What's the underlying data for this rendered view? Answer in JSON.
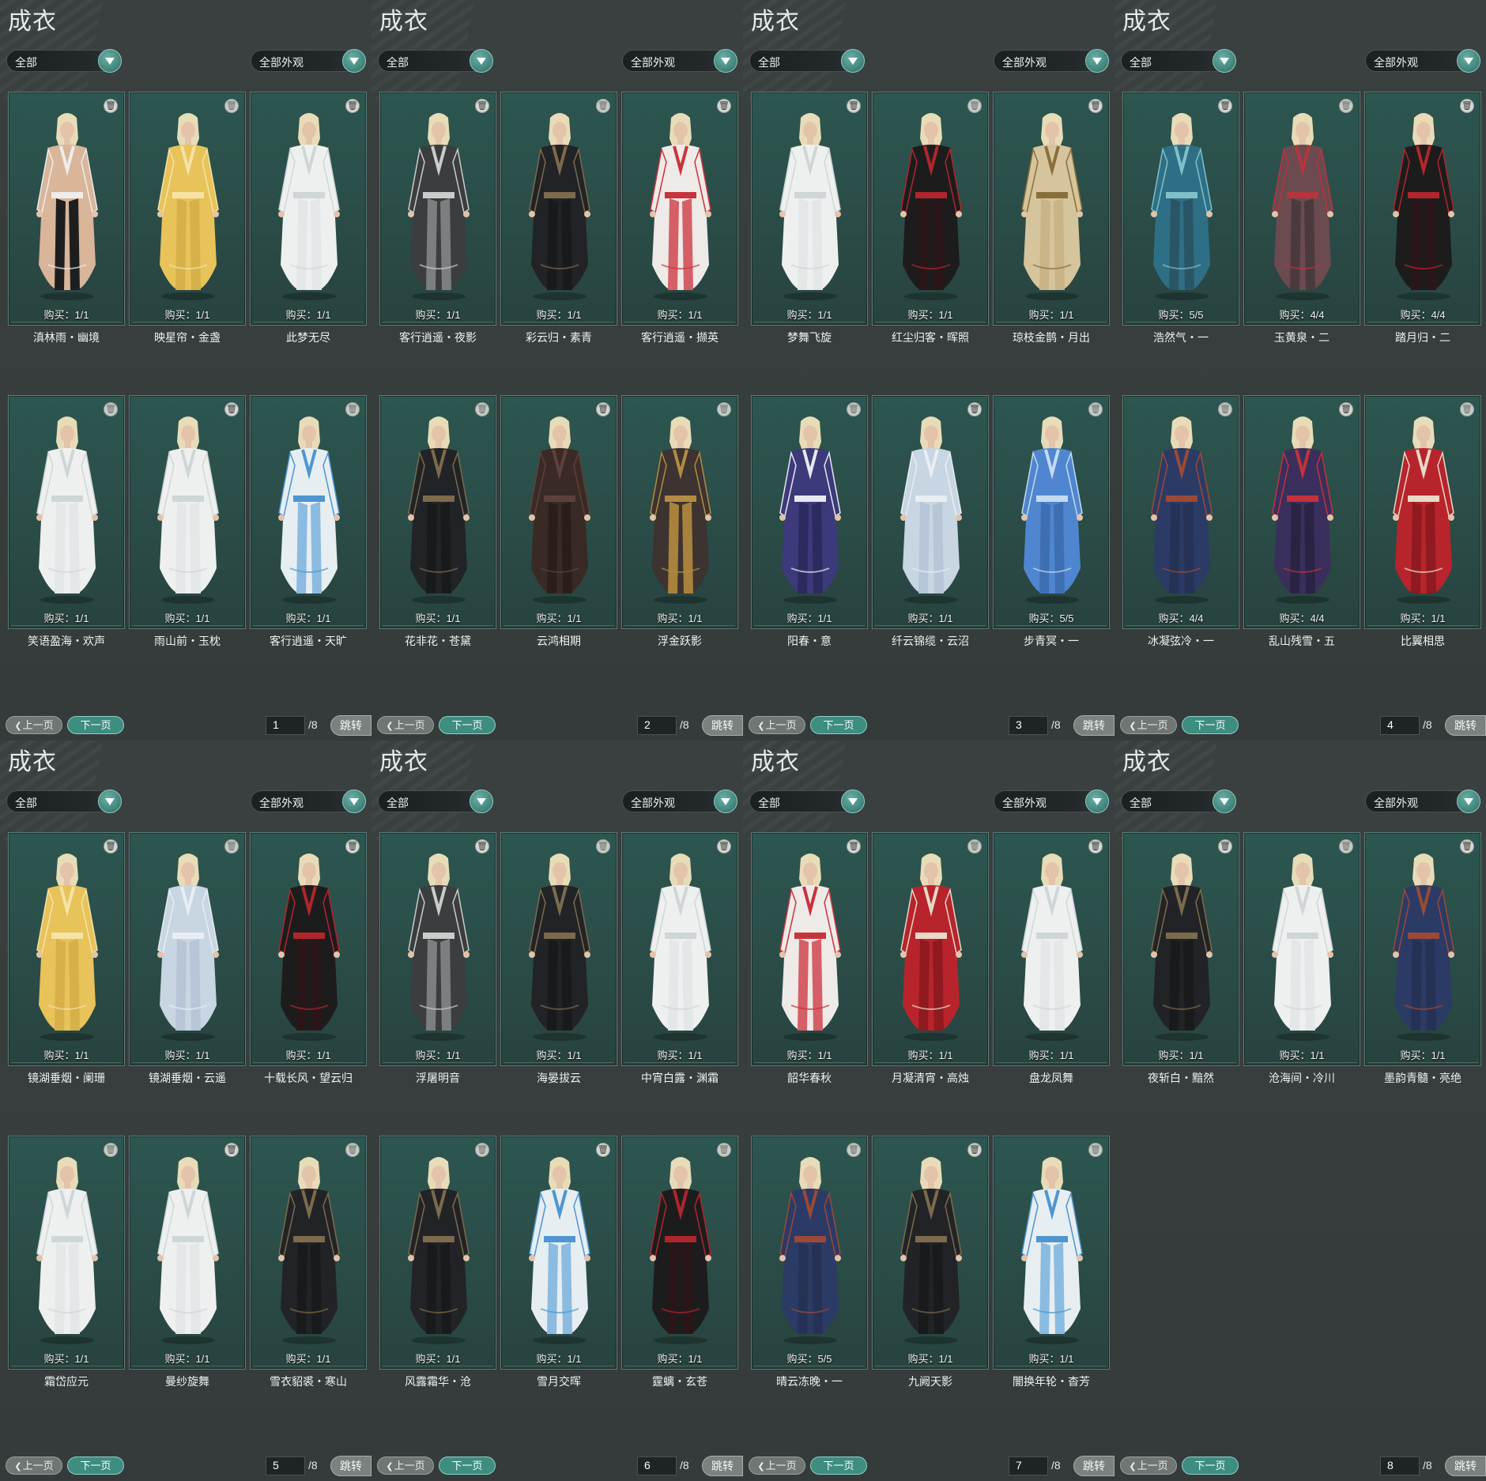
{
  "panels": [
    {
      "title": "成衣",
      "filter_category": "全部",
      "filter_appearance": "全部外观",
      "page": "1",
      "total_pages": "/8",
      "prev_label": "上一页",
      "next_label": "下一页",
      "jump_label": "跳转",
      "items": [
        {
          "name": "滇林雨・幽境",
          "purchase": "购买：1/1",
          "palette": "bare"
        },
        {
          "name": "映星帘・金盏",
          "purchase": "购买：1/1",
          "palette": "gold"
        },
        {
          "name": "此梦无尽",
          "purchase": "购买：1/1",
          "palette": "white"
        },
        {
          "name": "笑语盈海・欢声",
          "purchase": "购买：1/1",
          "palette": "white"
        },
        {
          "name": "雨山前・玉枕",
          "purchase": "购买：1/1",
          "palette": "white"
        },
        {
          "name": "客行逍遥・天旷",
          "purchase": "购买：1/1",
          "palette": "skyblue"
        }
      ]
    },
    {
      "title": "成衣",
      "filter_category": "全部",
      "filter_appearance": "全部外观",
      "page": "2",
      "total_pages": "/8",
      "prev_label": "上一页",
      "next_label": "下一页",
      "jump_label": "跳转",
      "items": [
        {
          "name": "客行逍遥・夜影",
          "purchase": "购买：1/1",
          "palette": "darkgrey"
        },
        {
          "name": "彩云归・素青",
          "purchase": "购买：1/1",
          "palette": "black"
        },
        {
          "name": "客行逍遥・撷英",
          "purchase": "购买：1/1",
          "palette": "whitered"
        },
        {
          "name": "花非花・苍黛",
          "purchase": "购买：1/1",
          "palette": "black"
        },
        {
          "name": "云鸿相期",
          "purchase": "购买：1/1",
          "palette": "darkbrown"
        },
        {
          "name": "浮金跃影",
          "purchase": "购买：1/1",
          "palette": "goldbrown"
        }
      ]
    },
    {
      "title": "成衣",
      "filter_category": "全部",
      "filter_appearance": "全部外观",
      "page": "3",
      "total_pages": "/8",
      "prev_label": "上一页",
      "next_label": "下一页",
      "jump_label": "跳转",
      "items": [
        {
          "name": "梦舞飞旋",
          "purchase": "购买：1/1",
          "palette": "white"
        },
        {
          "name": "红尘归客・晖照",
          "purchase": "购买：1/1",
          "palette": "blackred"
        },
        {
          "name": "琼枝金鹊・月出",
          "purchase": "购买：1/1",
          "palette": "beige"
        },
        {
          "name": "阳春・意",
          "purchase": "购买：1/1",
          "palette": "purple"
        },
        {
          "name": "纤云锦缆・云沼",
          "purchase": "购买：1/1",
          "palette": "paleblue"
        },
        {
          "name": "步青冥・一",
          "purchase": "购买：5/5",
          "palette": "blue"
        }
      ]
    },
    {
      "title": "成衣",
      "filter_category": "全部",
      "filter_appearance": "全部外观",
      "page": "4",
      "total_pages": "/8",
      "prev_label": "上一页",
      "next_label": "下一页",
      "jump_label": "跳转",
      "items": [
        {
          "name": "浩然气・一",
          "purchase": "购买：5/5",
          "palette": "teal"
        },
        {
          "name": "玉黄泉・二",
          "purchase": "购买：4/4",
          "palette": "redgrey"
        },
        {
          "name": "踏月归・二",
          "purchase": "购买：4/4",
          "palette": "blackred"
        },
        {
          "name": "冰凝弦冷・一",
          "purchase": "购买：4/4",
          "palette": "navy"
        },
        {
          "name": "乱山残雪・五",
          "purchase": "购买：4/4",
          "palette": "navyred"
        },
        {
          "name": "比翼相思",
          "purchase": "购买：1/1",
          "palette": "red"
        }
      ]
    },
    {
      "title": "成衣",
      "filter_category": "全部",
      "filter_appearance": "全部外观",
      "page": "5",
      "total_pages": "/8",
      "prev_label": "上一页",
      "next_label": "下一页",
      "jump_label": "跳转",
      "items": [
        {
          "name": "镜湖垂烟・阑珊",
          "purchase": "购买：1/1",
          "palette": "gold"
        },
        {
          "name": "镜湖垂烟・云遥",
          "purchase": "购买：1/1",
          "palette": "paleblue"
        },
        {
          "name": "十载长风・望云归",
          "purchase": "购买：1/1",
          "palette": "blackred"
        },
        {
          "name": "霜岱应元",
          "purchase": "购买：1/1",
          "palette": "white"
        },
        {
          "name": "曼纱旋舞",
          "purchase": "购买：1/1",
          "palette": "white"
        },
        {
          "name": "雪衣貂裘・寒山",
          "purchase": "购买：1/1",
          "palette": "black"
        }
      ]
    },
    {
      "title": "成衣",
      "filter_category": "全部",
      "filter_appearance": "全部外观",
      "page": "6",
      "total_pages": "/8",
      "prev_label": "上一页",
      "next_label": "下一页",
      "jump_label": "跳转",
      "items": [
        {
          "name": "浮屠明音",
          "purchase": "购买：1/1",
          "palette": "darkgrey"
        },
        {
          "name": "海晏拔云",
          "purchase": "购买：1/1",
          "palette": "black"
        },
        {
          "name": "中宵白露・渊霜",
          "purchase": "购买：1/1",
          "palette": "white"
        },
        {
          "name": "风露霜华・沧",
          "purchase": "购买：1/1",
          "palette": "black"
        },
        {
          "name": "雪月交晖",
          "purchase": "购买：1/1",
          "palette": "skyblue"
        },
        {
          "name": "霆螭・玄苍",
          "purchase": "购买：1/1",
          "palette": "blackred"
        }
      ]
    },
    {
      "title": "成衣",
      "filter_category": "全部",
      "filter_appearance": "全部外观",
      "page": "7",
      "total_pages": "/8",
      "prev_label": "上一页",
      "next_label": "下一页",
      "jump_label": "跳转",
      "items": [
        {
          "name": "韶华春秋",
          "purchase": "购买：1/1",
          "palette": "whitered"
        },
        {
          "name": "月凝清宵・高烛",
          "purchase": "购买：1/1",
          "palette": "red"
        },
        {
          "name": "盘龙凤舞",
          "purchase": "购买：1/1",
          "palette": "white"
        },
        {
          "name": "晴云冻晚・一",
          "purchase": "购买：5/5",
          "palette": "navy"
        },
        {
          "name": "九阙天影",
          "purchase": "购买：1/1",
          "palette": "black"
        },
        {
          "name": "闇换年轮・杳芳",
          "purchase": "购买：1/1",
          "palette": "skyblue"
        }
      ]
    },
    {
      "title": "成衣",
      "filter_category": "全部",
      "filter_appearance": "全部外观",
      "page": "8",
      "total_pages": "/8",
      "prev_label": "上一页",
      "next_label": "下一页",
      "jump_label": "跳转",
      "items": [
        {
          "name": "夜斩白・黯然",
          "purchase": "购买：1/1",
          "palette": "black"
        },
        {
          "name": "沧海间・冷川",
          "purchase": "购买：1/1",
          "palette": "white"
        },
        {
          "name": "墨韵青髓・亮绝",
          "purchase": "购买：1/1",
          "palette": "navy"
        }
      ]
    }
  ],
  "palettes": {
    "bare": {
      "robe": "#d9b59a",
      "trim": "#ededed",
      "pants": "#1e1e1e"
    },
    "gold": {
      "robe": "#e7c35a",
      "trim": "#f5e3a6",
      "pants": "#d7b04a"
    },
    "white": {
      "robe": "#eef0f0",
      "trim": "#cfd6d8",
      "pants": "#e3e7e8"
    },
    "skyblue": {
      "robe": "#e6eef2",
      "trim": "#4f95cf",
      "pants": "#8bbbe0"
    },
    "darkgrey": {
      "robe": "#3b3d3f",
      "trim": "#c9ccca",
      "pants": "#7b7f80"
    },
    "black": {
      "robe": "#222326",
      "trim": "#7c6b4c",
      "pants": "#191a1c"
    },
    "whitered": {
      "robe": "#eeeae8",
      "trim": "#c8343b",
      "pants": "#d45f66"
    },
    "darkbrown": {
      "robe": "#3a2a26",
      "trim": "#5c413a",
      "pants": "#2a1e1c"
    },
    "goldbrown": {
      "robe": "#3d3330",
      "trim": "#b38b43",
      "pants": "#a8823c"
    },
    "blackred": {
      "robe": "#1d1c1d",
      "trim": "#b0262c",
      "pants": "#2a1618"
    },
    "beige": {
      "robe": "#d6c49c",
      "trim": "#8a6e3c",
      "pants": "#c9b487"
    },
    "purple": {
      "robe": "#3c3a7a",
      "trim": "#e8e8f0",
      "pants": "#2c2a5e"
    },
    "paleblue": {
      "robe": "#c8d5e2",
      "trim": "#e8eef3",
      "pants": "#b6c6d6"
    },
    "blue": {
      "robe": "#4f86cf",
      "trim": "#c3daf2",
      "pants": "#3f6fb3"
    },
    "teal": {
      "robe": "#2f6f86",
      "trim": "#7fc0c8",
      "pants": "#2a5566"
    },
    "redgrey": {
      "robe": "#6b4a50",
      "trim": "#b8343e",
      "pants": "#4a3a3e"
    },
    "navy": {
      "robe": "#2c3a66",
      "trim": "#9a4a36",
      "pants": "#263255"
    },
    "navyred": {
      "robe": "#3a2f5c",
      "trim": "#c2323a",
      "pants": "#2a2344"
    },
    "red": {
      "robe": "#b8242c",
      "trim": "#ead8c8",
      "pants": "#8f1a20"
    }
  }
}
